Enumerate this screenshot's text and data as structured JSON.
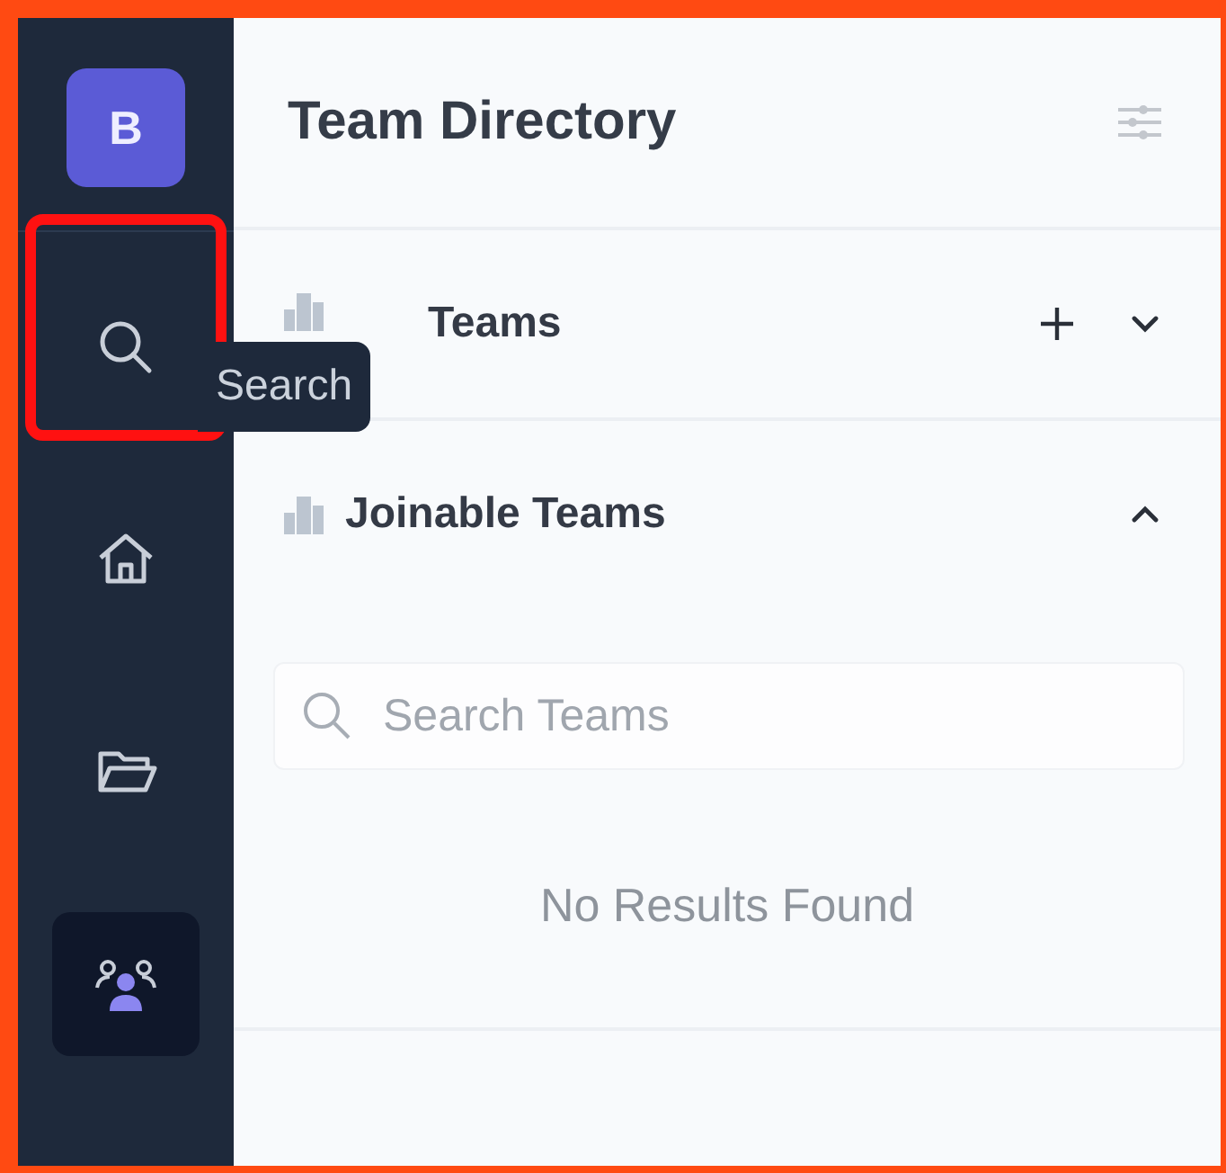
{
  "sidebar": {
    "logo": "B",
    "items": [
      {
        "kind": "search",
        "selected": false,
        "highlighted": true
      },
      {
        "kind": "home",
        "selected": false,
        "highlighted": false
      },
      {
        "kind": "folder",
        "selected": false,
        "highlighted": false
      },
      {
        "kind": "teams",
        "selected": true,
        "highlighted": false
      }
    ],
    "tooltip": "Search"
  },
  "main": {
    "title": "Team Directory",
    "sections": [
      {
        "label": "Teams",
        "expanded": false,
        "can_add": true
      },
      {
        "label": "Joinable Teams",
        "expanded": true,
        "can_add": false,
        "search": {
          "placeholder": "Search Teams"
        },
        "empty_message": "No Results Found"
      }
    ]
  }
}
